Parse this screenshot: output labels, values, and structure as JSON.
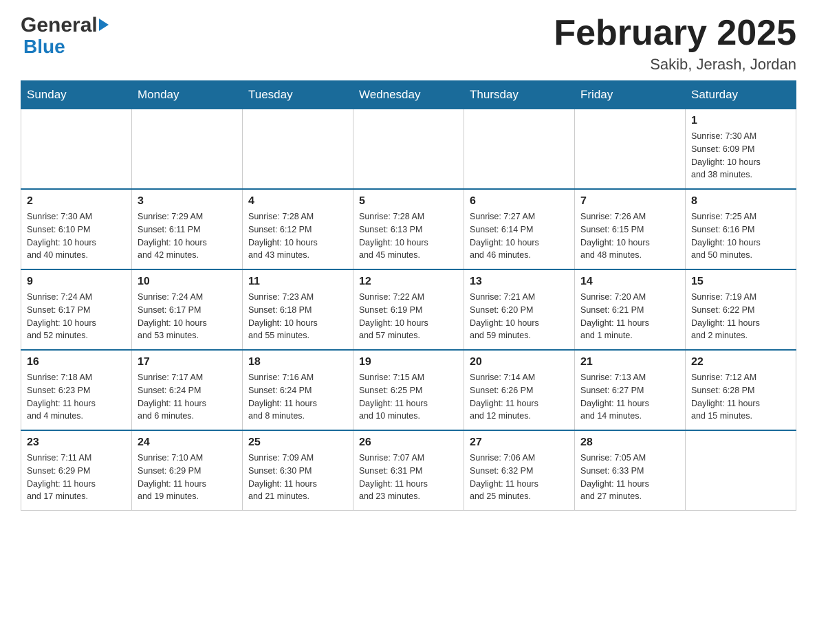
{
  "header": {
    "logo": {
      "general": "General",
      "blue": "Blue",
      "arrow_color": "#1a7abf"
    },
    "title": "February 2025",
    "subtitle": "Sakib, Jerash, Jordan"
  },
  "weekdays": [
    "Sunday",
    "Monday",
    "Tuesday",
    "Wednesday",
    "Thursday",
    "Friday",
    "Saturday"
  ],
  "weeks": [
    [
      {
        "day": "",
        "info": ""
      },
      {
        "day": "",
        "info": ""
      },
      {
        "day": "",
        "info": ""
      },
      {
        "day": "",
        "info": ""
      },
      {
        "day": "",
        "info": ""
      },
      {
        "day": "",
        "info": ""
      },
      {
        "day": "1",
        "info": "Sunrise: 7:30 AM\nSunset: 6:09 PM\nDaylight: 10 hours\nand 38 minutes."
      }
    ],
    [
      {
        "day": "2",
        "info": "Sunrise: 7:30 AM\nSunset: 6:10 PM\nDaylight: 10 hours\nand 40 minutes."
      },
      {
        "day": "3",
        "info": "Sunrise: 7:29 AM\nSunset: 6:11 PM\nDaylight: 10 hours\nand 42 minutes."
      },
      {
        "day": "4",
        "info": "Sunrise: 7:28 AM\nSunset: 6:12 PM\nDaylight: 10 hours\nand 43 minutes."
      },
      {
        "day": "5",
        "info": "Sunrise: 7:28 AM\nSunset: 6:13 PM\nDaylight: 10 hours\nand 45 minutes."
      },
      {
        "day": "6",
        "info": "Sunrise: 7:27 AM\nSunset: 6:14 PM\nDaylight: 10 hours\nand 46 minutes."
      },
      {
        "day": "7",
        "info": "Sunrise: 7:26 AM\nSunset: 6:15 PM\nDaylight: 10 hours\nand 48 minutes."
      },
      {
        "day": "8",
        "info": "Sunrise: 7:25 AM\nSunset: 6:16 PM\nDaylight: 10 hours\nand 50 minutes."
      }
    ],
    [
      {
        "day": "9",
        "info": "Sunrise: 7:24 AM\nSunset: 6:17 PM\nDaylight: 10 hours\nand 52 minutes."
      },
      {
        "day": "10",
        "info": "Sunrise: 7:24 AM\nSunset: 6:17 PM\nDaylight: 10 hours\nand 53 minutes."
      },
      {
        "day": "11",
        "info": "Sunrise: 7:23 AM\nSunset: 6:18 PM\nDaylight: 10 hours\nand 55 minutes."
      },
      {
        "day": "12",
        "info": "Sunrise: 7:22 AM\nSunset: 6:19 PM\nDaylight: 10 hours\nand 57 minutes."
      },
      {
        "day": "13",
        "info": "Sunrise: 7:21 AM\nSunset: 6:20 PM\nDaylight: 10 hours\nand 59 minutes."
      },
      {
        "day": "14",
        "info": "Sunrise: 7:20 AM\nSunset: 6:21 PM\nDaylight: 11 hours\nand 1 minute."
      },
      {
        "day": "15",
        "info": "Sunrise: 7:19 AM\nSunset: 6:22 PM\nDaylight: 11 hours\nand 2 minutes."
      }
    ],
    [
      {
        "day": "16",
        "info": "Sunrise: 7:18 AM\nSunset: 6:23 PM\nDaylight: 11 hours\nand 4 minutes."
      },
      {
        "day": "17",
        "info": "Sunrise: 7:17 AM\nSunset: 6:24 PM\nDaylight: 11 hours\nand 6 minutes."
      },
      {
        "day": "18",
        "info": "Sunrise: 7:16 AM\nSunset: 6:24 PM\nDaylight: 11 hours\nand 8 minutes."
      },
      {
        "day": "19",
        "info": "Sunrise: 7:15 AM\nSunset: 6:25 PM\nDaylight: 11 hours\nand 10 minutes."
      },
      {
        "day": "20",
        "info": "Sunrise: 7:14 AM\nSunset: 6:26 PM\nDaylight: 11 hours\nand 12 minutes."
      },
      {
        "day": "21",
        "info": "Sunrise: 7:13 AM\nSunset: 6:27 PM\nDaylight: 11 hours\nand 14 minutes."
      },
      {
        "day": "22",
        "info": "Sunrise: 7:12 AM\nSunset: 6:28 PM\nDaylight: 11 hours\nand 15 minutes."
      }
    ],
    [
      {
        "day": "23",
        "info": "Sunrise: 7:11 AM\nSunset: 6:29 PM\nDaylight: 11 hours\nand 17 minutes."
      },
      {
        "day": "24",
        "info": "Sunrise: 7:10 AM\nSunset: 6:29 PM\nDaylight: 11 hours\nand 19 minutes."
      },
      {
        "day": "25",
        "info": "Sunrise: 7:09 AM\nSunset: 6:30 PM\nDaylight: 11 hours\nand 21 minutes."
      },
      {
        "day": "26",
        "info": "Sunrise: 7:07 AM\nSunset: 6:31 PM\nDaylight: 11 hours\nand 23 minutes."
      },
      {
        "day": "27",
        "info": "Sunrise: 7:06 AM\nSunset: 6:32 PM\nDaylight: 11 hours\nand 25 minutes."
      },
      {
        "day": "28",
        "info": "Sunrise: 7:05 AM\nSunset: 6:33 PM\nDaylight: 11 hours\nand 27 minutes."
      },
      {
        "day": "",
        "info": ""
      }
    ]
  ]
}
